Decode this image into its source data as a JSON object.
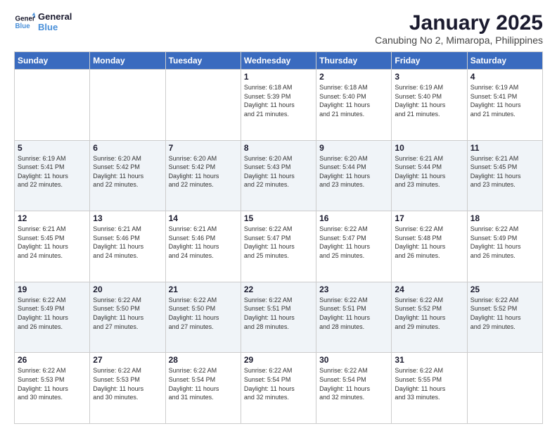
{
  "logo": {
    "text_general": "General",
    "text_blue": "Blue"
  },
  "header": {
    "title": "January 2025",
    "subtitle": "Canubing No 2, Mimaropa, Philippines"
  },
  "weekdays": [
    "Sunday",
    "Monday",
    "Tuesday",
    "Wednesday",
    "Thursday",
    "Friday",
    "Saturday"
  ],
  "weeks": [
    [
      {
        "day": "",
        "info": ""
      },
      {
        "day": "",
        "info": ""
      },
      {
        "day": "",
        "info": ""
      },
      {
        "day": "1",
        "info": "Sunrise: 6:18 AM\nSunset: 5:39 PM\nDaylight: 11 hours\nand 21 minutes."
      },
      {
        "day": "2",
        "info": "Sunrise: 6:18 AM\nSunset: 5:40 PM\nDaylight: 11 hours\nand 21 minutes."
      },
      {
        "day": "3",
        "info": "Sunrise: 6:19 AM\nSunset: 5:40 PM\nDaylight: 11 hours\nand 21 minutes."
      },
      {
        "day": "4",
        "info": "Sunrise: 6:19 AM\nSunset: 5:41 PM\nDaylight: 11 hours\nand 21 minutes."
      }
    ],
    [
      {
        "day": "5",
        "info": "Sunrise: 6:19 AM\nSunset: 5:41 PM\nDaylight: 11 hours\nand 22 minutes."
      },
      {
        "day": "6",
        "info": "Sunrise: 6:20 AM\nSunset: 5:42 PM\nDaylight: 11 hours\nand 22 minutes."
      },
      {
        "day": "7",
        "info": "Sunrise: 6:20 AM\nSunset: 5:42 PM\nDaylight: 11 hours\nand 22 minutes."
      },
      {
        "day": "8",
        "info": "Sunrise: 6:20 AM\nSunset: 5:43 PM\nDaylight: 11 hours\nand 22 minutes."
      },
      {
        "day": "9",
        "info": "Sunrise: 6:20 AM\nSunset: 5:44 PM\nDaylight: 11 hours\nand 23 minutes."
      },
      {
        "day": "10",
        "info": "Sunrise: 6:21 AM\nSunset: 5:44 PM\nDaylight: 11 hours\nand 23 minutes."
      },
      {
        "day": "11",
        "info": "Sunrise: 6:21 AM\nSunset: 5:45 PM\nDaylight: 11 hours\nand 23 minutes."
      }
    ],
    [
      {
        "day": "12",
        "info": "Sunrise: 6:21 AM\nSunset: 5:45 PM\nDaylight: 11 hours\nand 24 minutes."
      },
      {
        "day": "13",
        "info": "Sunrise: 6:21 AM\nSunset: 5:46 PM\nDaylight: 11 hours\nand 24 minutes."
      },
      {
        "day": "14",
        "info": "Sunrise: 6:21 AM\nSunset: 5:46 PM\nDaylight: 11 hours\nand 24 minutes."
      },
      {
        "day": "15",
        "info": "Sunrise: 6:22 AM\nSunset: 5:47 PM\nDaylight: 11 hours\nand 25 minutes."
      },
      {
        "day": "16",
        "info": "Sunrise: 6:22 AM\nSunset: 5:47 PM\nDaylight: 11 hours\nand 25 minutes."
      },
      {
        "day": "17",
        "info": "Sunrise: 6:22 AM\nSunset: 5:48 PM\nDaylight: 11 hours\nand 26 minutes."
      },
      {
        "day": "18",
        "info": "Sunrise: 6:22 AM\nSunset: 5:49 PM\nDaylight: 11 hours\nand 26 minutes."
      }
    ],
    [
      {
        "day": "19",
        "info": "Sunrise: 6:22 AM\nSunset: 5:49 PM\nDaylight: 11 hours\nand 26 minutes."
      },
      {
        "day": "20",
        "info": "Sunrise: 6:22 AM\nSunset: 5:50 PM\nDaylight: 11 hours\nand 27 minutes."
      },
      {
        "day": "21",
        "info": "Sunrise: 6:22 AM\nSunset: 5:50 PM\nDaylight: 11 hours\nand 27 minutes."
      },
      {
        "day": "22",
        "info": "Sunrise: 6:22 AM\nSunset: 5:51 PM\nDaylight: 11 hours\nand 28 minutes."
      },
      {
        "day": "23",
        "info": "Sunrise: 6:22 AM\nSunset: 5:51 PM\nDaylight: 11 hours\nand 28 minutes."
      },
      {
        "day": "24",
        "info": "Sunrise: 6:22 AM\nSunset: 5:52 PM\nDaylight: 11 hours\nand 29 minutes."
      },
      {
        "day": "25",
        "info": "Sunrise: 6:22 AM\nSunset: 5:52 PM\nDaylight: 11 hours\nand 29 minutes."
      }
    ],
    [
      {
        "day": "26",
        "info": "Sunrise: 6:22 AM\nSunset: 5:53 PM\nDaylight: 11 hours\nand 30 minutes."
      },
      {
        "day": "27",
        "info": "Sunrise: 6:22 AM\nSunset: 5:53 PM\nDaylight: 11 hours\nand 30 minutes."
      },
      {
        "day": "28",
        "info": "Sunrise: 6:22 AM\nSunset: 5:54 PM\nDaylight: 11 hours\nand 31 minutes."
      },
      {
        "day": "29",
        "info": "Sunrise: 6:22 AM\nSunset: 5:54 PM\nDaylight: 11 hours\nand 32 minutes."
      },
      {
        "day": "30",
        "info": "Sunrise: 6:22 AM\nSunset: 5:54 PM\nDaylight: 11 hours\nand 32 minutes."
      },
      {
        "day": "31",
        "info": "Sunrise: 6:22 AM\nSunset: 5:55 PM\nDaylight: 11 hours\nand 33 minutes."
      },
      {
        "day": "",
        "info": ""
      }
    ]
  ]
}
